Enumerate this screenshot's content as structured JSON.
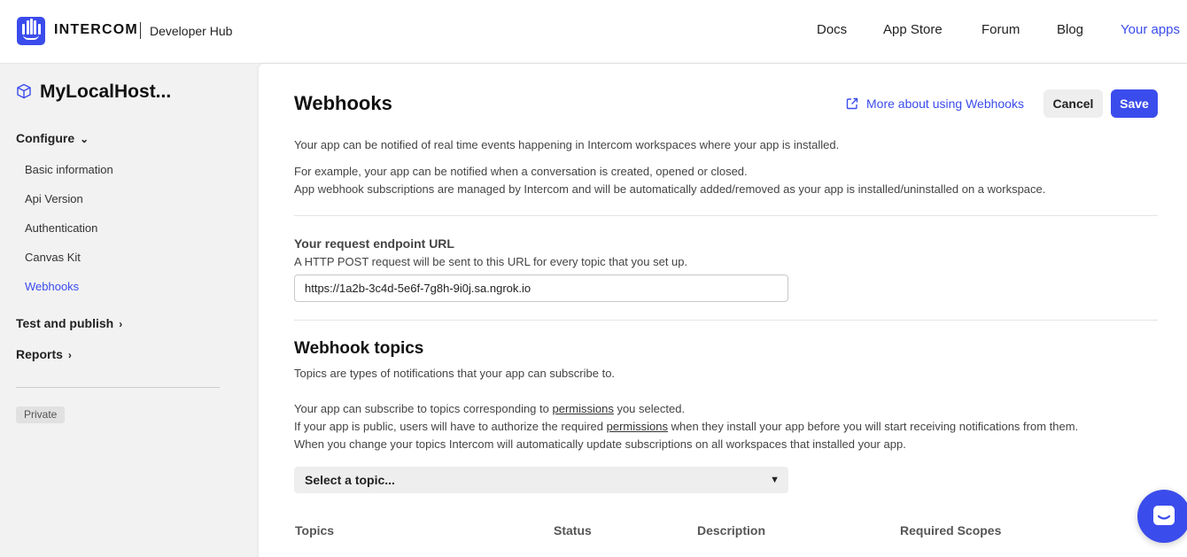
{
  "header": {
    "brand": "INTERCOM",
    "subtitle": "Developer Hub",
    "nav": [
      {
        "label": "Docs"
      },
      {
        "label": "App Store"
      },
      {
        "label": "Forum"
      },
      {
        "label": "Blog"
      },
      {
        "label": "Your apps"
      }
    ]
  },
  "sidebar": {
    "app_icon": "cube-icon",
    "app_name": "MyLocalHost...",
    "configure_label": "Configure",
    "configure_items": [
      {
        "label": "Basic information"
      },
      {
        "label": "Api Version"
      },
      {
        "label": "Authentication"
      },
      {
        "label": "Canvas Kit"
      },
      {
        "label": "Webhooks"
      }
    ],
    "test_publish_label": "Test and publish",
    "reports_label": "Reports",
    "badge": "Private"
  },
  "main": {
    "title": "Webhooks",
    "help_link": "More about using Webhooks",
    "cancel_label": "Cancel",
    "save_label": "Save",
    "intro_1": "Your app can be notified of real time events happening in Intercom workspaces where your app is installed.",
    "intro_2": "For example, your app can be notified when a conversation is created, opened or closed.",
    "intro_3": "App webhook subscriptions are managed by Intercom and will be automatically added/removed as your app is installed/uninstalled on a workspace.",
    "endpoint_label": "Your request endpoint URL",
    "endpoint_help": "A HTTP POST request will be sent to this URL for every topic that you set up.",
    "endpoint_value": "https://1a2b-3c4d-5e6f-7g8h-9i0j.sa.ngrok.io",
    "topics_heading": "Webhook topics",
    "topics_intro": "Topics are types of notifications that your app can subscribe to.",
    "topics_p1_a": "Your app can subscribe to topics corresponding to ",
    "topics_p1_link": "permissions",
    "topics_p1_b": " you selected.",
    "topics_p2_a": "If your app is public, users will have to authorize the required ",
    "topics_p2_link": "permissions",
    "topics_p2_b": " when they install your app before you will start receiving notifications from them.",
    "topics_p3": "When you change your topics Intercom will automatically update subscriptions on all workspaces that installed your app.",
    "select_placeholder": "Select a topic...",
    "table_headers": [
      "Topics",
      "Status",
      "Description",
      "Required Scopes"
    ]
  },
  "colors": {
    "accent": "#3b4cec"
  }
}
